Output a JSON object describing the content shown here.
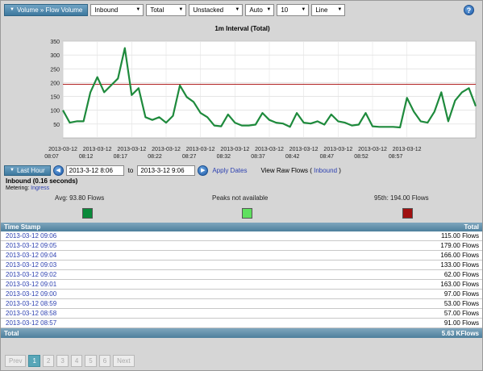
{
  "toolbar": {
    "breadcrumb": "Volume » Flow Volume",
    "selects": [
      {
        "value": "Inbound",
        "width": 66
      },
      {
        "value": "Total",
        "width": 50
      },
      {
        "value": "Unstacked",
        "width": 67
      },
      {
        "value": "Auto",
        "width": 36
      },
      {
        "value": "10",
        "width": 40
      },
      {
        "value": "Line",
        "width": 42
      }
    ],
    "help_label": "?"
  },
  "chart_data": {
    "type": "line",
    "title": "1m Interval (Total)",
    "ylim": [
      0,
      350
    ],
    "yticks": [
      50,
      100,
      150,
      200,
      250,
      300,
      350
    ],
    "grid": true,
    "threshold": 194,
    "x_tick_labels": [
      {
        "date": "2013-03-12",
        "time": "08:07"
      },
      {
        "date": "2013-03-12",
        "time": "08:12"
      },
      {
        "date": "2013-03-12",
        "time": "08:17"
      },
      {
        "date": "2013-03-12",
        "time": "08:22"
      },
      {
        "date": "2013-03-12",
        "time": "08:27"
      },
      {
        "date": "2013-03-12",
        "time": "08:32"
      },
      {
        "date": "2013-03-12",
        "time": "08:37"
      },
      {
        "date": "2013-03-12",
        "time": "08:42"
      },
      {
        "date": "2013-03-12",
        "time": "08:47"
      },
      {
        "date": "2013-03-12",
        "time": "08:52"
      },
      {
        "date": "2013-03-12",
        "time": "08:57"
      }
    ],
    "series": [
      {
        "color": "#1e8a3c",
        "values": [
          100,
          55,
          60,
          60,
          165,
          220,
          165,
          190,
          215,
          325,
          155,
          180,
          75,
          65,
          75,
          55,
          80,
          190,
          148,
          130,
          90,
          75,
          45,
          42,
          85,
          55,
          45,
          45,
          48,
          90,
          65,
          55,
          52,
          40,
          90,
          55,
          52,
          60,
          48,
          85,
          60,
          55,
          45,
          48,
          90,
          42,
          40,
          40,
          40,
          38,
          145,
          95,
          60,
          55,
          95,
          165,
          60,
          135,
          165,
          180,
          115
        ]
      }
    ]
  },
  "range": {
    "preset": "Last Hour",
    "start": "2013-3-12 8:06",
    "to_label": "to",
    "end": "2013-3-12 9:06",
    "apply": "Apply Dates",
    "raw_prefix": "View Raw Flows (",
    "raw_link": "Inbound",
    "raw_suffix": ")"
  },
  "info": {
    "heading": "Inbound (0.16 seconds)",
    "metering_label": "Metering:",
    "metering_value": "Ingress"
  },
  "stats": {
    "avg": "Avg: 93.80 Flows",
    "peaks": "Peaks not available",
    "p95": "95th: 194.00 Flows",
    "avg_color": "#0a8a3a",
    "peaks_color": "#5ee05e",
    "p95_color": "#a01010"
  },
  "table": {
    "columns": [
      "Time Stamp",
      "Total"
    ],
    "rows": [
      [
        "2013-03-12 09:06",
        "115.00 Flows"
      ],
      [
        "2013-03-12 09:05",
        "179.00 Flows"
      ],
      [
        "2013-03-12 09:04",
        "166.00 Flows"
      ],
      [
        "2013-03-12 09:03",
        "133.00 Flows"
      ],
      [
        "2013-03-12 09:02",
        "62.00 Flows"
      ],
      [
        "2013-03-12 09:01",
        "163.00 Flows"
      ],
      [
        "2013-03-12 09:00",
        "97.00 Flows"
      ],
      [
        "2013-03-12 08:59",
        "53.00 Flows"
      ],
      [
        "2013-03-12 08:58",
        "57.00 Flows"
      ],
      [
        "2013-03-12 08:57",
        "91.00 Flows"
      ]
    ],
    "footer_label": "Total",
    "footer_value": "5.63 KFlows"
  },
  "pager": {
    "prev": "Prev",
    "pages": [
      "1",
      "2",
      "3",
      "4",
      "5",
      "6"
    ],
    "current": "1",
    "next": "Next"
  }
}
